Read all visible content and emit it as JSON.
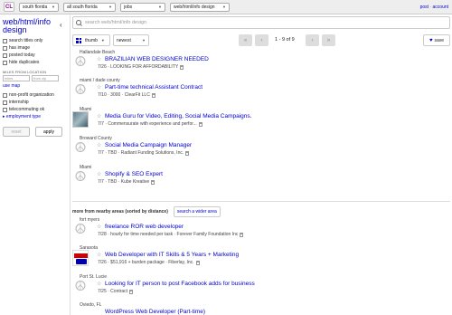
{
  "topbar": {
    "logo": "CL",
    "selects": [
      "south florida",
      "all south florida",
      "jobs",
      "web/html/info design"
    ],
    "account_post": "post",
    "account_sep": "·",
    "account_account": "account"
  },
  "sidebar": {
    "title": "web/html/info design",
    "collapse_icon": "chevron-left",
    "options": [
      "search titles only",
      "has image",
      "posted today",
      "hide duplicates"
    ],
    "miles_label": "MILES FROM LOCATION",
    "miles_placeholder": "miles",
    "zip_placeholder": "from zip",
    "map_link": "use map",
    "job_options": [
      "non-profit organization",
      "internship",
      "telecommuting ok"
    ],
    "employment_type": "employment type",
    "reset_label": "reset",
    "apply_label": "apply"
  },
  "search": {
    "placeholder": "search web/html/info design"
  },
  "toolbar": {
    "view_label": "thumb",
    "sort_label": "newest",
    "page_count": "1 - 9 of 9",
    "save_label": "save"
  },
  "results": [
    {
      "location": "Hallandale Beach",
      "title": "BRAZILIAN WEB DESIGNER NEEDED",
      "meta": "7/26 · LOOKING FOR AFFORDABILITY",
      "thumb": "peace"
    },
    {
      "location": "miami / dade county",
      "title": "Part-time technical Assistant Contract",
      "meta": "7/10 · 3000 · ClearFit LLC",
      "thumb": "peace"
    },
    {
      "location": "Miami",
      "title": "Media Guru for Video, Editing, Social Media Campaigns.",
      "meta": "7/7 · Commensurate with experience and perfor...",
      "thumb": "pic"
    },
    {
      "location": "Broward County",
      "title": "Social Media Campaign Manager",
      "meta": "7/7 · TBD · Radiant Funding Solutions, Inc.",
      "thumb": "peace"
    },
    {
      "location": "Miami",
      "title": "Shopify & SEO Expert",
      "meta": "7/7 · TBD · Kube Kreative",
      "thumb": "peace"
    }
  ],
  "nearby": {
    "label": "more from nearby areas (sorted by distance)",
    "wider_label": "search a wider area"
  },
  "nearby_results": [
    {
      "location": "fort myers",
      "title": "freelance ROR web developer",
      "meta": "7/28 · hourly for time needed per task · Forever Family Foundation Inc",
      "thumb": "peace"
    },
    {
      "location": "Sarasota",
      "title": "Web Developer with IT Skills & 5 Years + Marketing",
      "meta": "7/26 · $51,916 + burden package · Fiberlay, Inc.",
      "thumb": "logo"
    },
    {
      "location": "Port St. Lucie",
      "title": "Looking for IT person to post Facebook adds for business",
      "meta": "7/25 · Contract",
      "thumb": "peace"
    },
    {
      "location": "Oviedo, FL",
      "title": "WordPress Web Developer (Part-time)",
      "meta": "",
      "thumb": "peace"
    }
  ]
}
